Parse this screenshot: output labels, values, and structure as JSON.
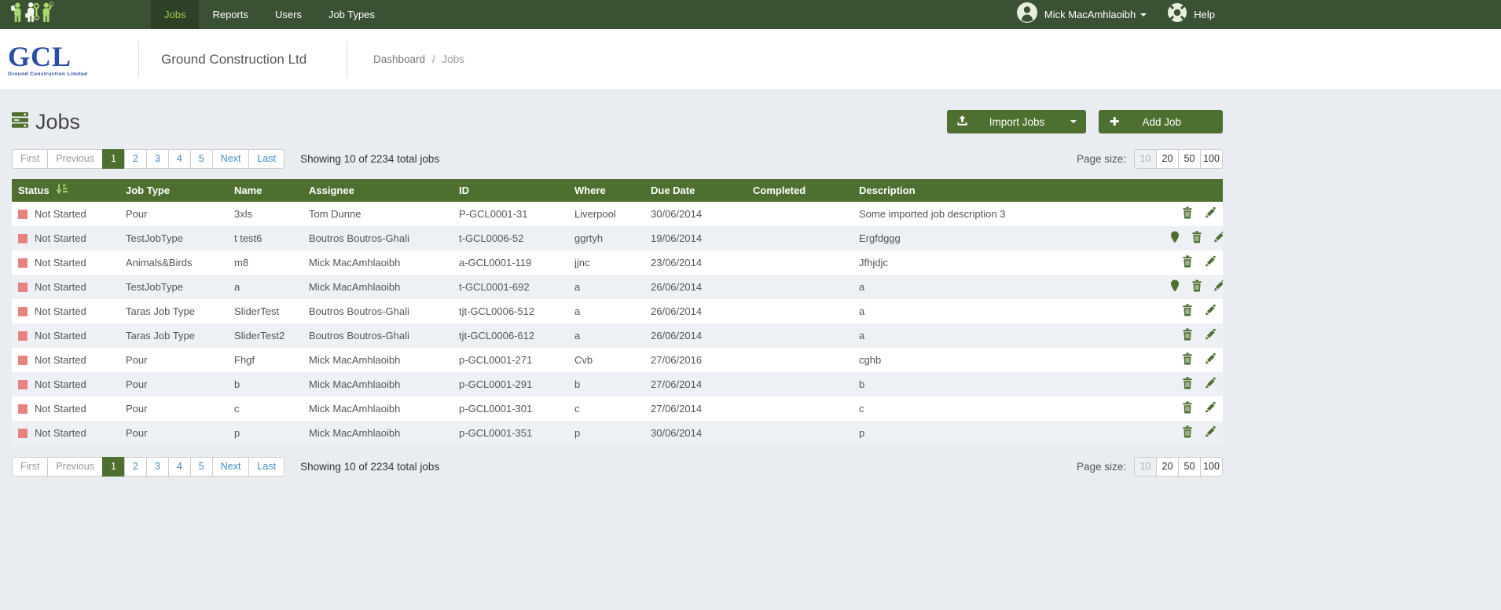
{
  "navbar": {
    "items": [
      {
        "label": "Jobs",
        "active": true
      },
      {
        "label": "Reports",
        "active": false
      },
      {
        "label": "Users",
        "active": false
      },
      {
        "label": "Job Types",
        "active": false
      }
    ],
    "user_name": "Mick MacAmhlaoibh",
    "help_label": "Help"
  },
  "header": {
    "logo_text": "GCL",
    "logo_subtext": "Ground Construction Limited",
    "company": "Ground Construction Ltd",
    "breadcrumb": [
      "Dashboard",
      "Jobs"
    ],
    "breadcrumb_separator": "/"
  },
  "page": {
    "title": "Jobs",
    "import_button": "Import Jobs",
    "add_button": "Add Job",
    "plus_glyph": "✚"
  },
  "pagination": {
    "first": "First",
    "previous": "Previous",
    "pages": [
      "1",
      "2",
      "3",
      "4",
      "5"
    ],
    "active_page": "1",
    "next": "Next",
    "last": "Last",
    "summary": "Showing 10 of 2234 total jobs",
    "page_size_label": "Page size:",
    "page_sizes": [
      "10",
      "20",
      "50",
      "100"
    ],
    "active_page_size": "10"
  },
  "table": {
    "columns": [
      "Status",
      "Job Type",
      "Name",
      "Assignee",
      "ID",
      "Where",
      "Due Date",
      "Completed",
      "Description"
    ],
    "rows": [
      {
        "status": "Not Started",
        "job_type": "Pour",
        "name": "3xls",
        "assignee": "Tom Dunne",
        "id": "P-GCL0001-31",
        "where": "Liverpool",
        "due_date": "30/06/2014",
        "completed": "",
        "description": "Some imported job description 3",
        "has_pin": false
      },
      {
        "status": "Not Started",
        "job_type": "TestJobType",
        "name": "t test6",
        "assignee": "Boutros Boutros-Ghali",
        "id": "t-GCL0006-52",
        "where": "ggrtyh",
        "due_date": "19/06/2014",
        "completed": "",
        "description": "Ergfdggg",
        "has_pin": true
      },
      {
        "status": "Not Started",
        "job_type": "Animals&Birds",
        "name": "m8",
        "assignee": "Mick MacAmhlaoibh",
        "id": "a-GCL0001-119",
        "where": "jjnc",
        "due_date": "23/06/2014",
        "completed": "",
        "description": "Jfhjdjc",
        "has_pin": false
      },
      {
        "status": "Not Started",
        "job_type": "TestJobType",
        "name": "a",
        "assignee": "Mick MacAmhlaoibh",
        "id": "t-GCL0001-692",
        "where": "a",
        "due_date": "26/06/2014",
        "completed": "",
        "description": "a",
        "has_pin": true
      },
      {
        "status": "Not Started",
        "job_type": "Taras Job Type",
        "name": "SliderTest",
        "assignee": "Boutros Boutros-Ghali",
        "id": "tjt-GCL0006-512",
        "where": "a",
        "due_date": "26/06/2014",
        "completed": "",
        "description": "a",
        "has_pin": false
      },
      {
        "status": "Not Started",
        "job_type": "Taras Job Type",
        "name": "SliderTest2",
        "assignee": "Boutros Boutros-Ghali",
        "id": "tjt-GCL0006-612",
        "where": "a",
        "due_date": "26/06/2014",
        "completed": "",
        "description": "a",
        "has_pin": false
      },
      {
        "status": "Not Started",
        "job_type": "Pour",
        "name": "Fhgf",
        "assignee": "Mick MacAmhlaoibh",
        "id": "p-GCL0001-271",
        "where": "Cvb",
        "due_date": "27/06/2016",
        "completed": "",
        "description": "cghb",
        "has_pin": false
      },
      {
        "status": "Not Started",
        "job_type": "Pour",
        "name": "b",
        "assignee": "Mick MacAmhlaoibh",
        "id": "p-GCL0001-291",
        "where": "b",
        "due_date": "27/06/2014",
        "completed": "",
        "description": "b",
        "has_pin": false
      },
      {
        "status": "Not Started",
        "job_type": "Pour",
        "name": "c",
        "assignee": "Mick MacAmhlaoibh",
        "id": "p-GCL0001-301",
        "where": "c",
        "due_date": "27/06/2014",
        "completed": "",
        "description": "c",
        "has_pin": false
      },
      {
        "status": "Not Started",
        "job_type": "Pour",
        "name": "p",
        "assignee": "Mick MacAmhlaoibh",
        "id": "p-GCL0001-351",
        "where": "p",
        "due_date": "30/06/2014",
        "completed": "",
        "description": "p",
        "has_pin": false
      }
    ]
  },
  "colors": {
    "navbar": "#3b5134",
    "navbar_active_bg": "#2e4126",
    "navbar_active_text": "#97d054",
    "accent_green": "#4d6f2f",
    "status_not_started": "#e8827e",
    "link_blue": "#428bca",
    "page_background": "#e9edf2",
    "row_alt_background": "#edf0f4"
  }
}
